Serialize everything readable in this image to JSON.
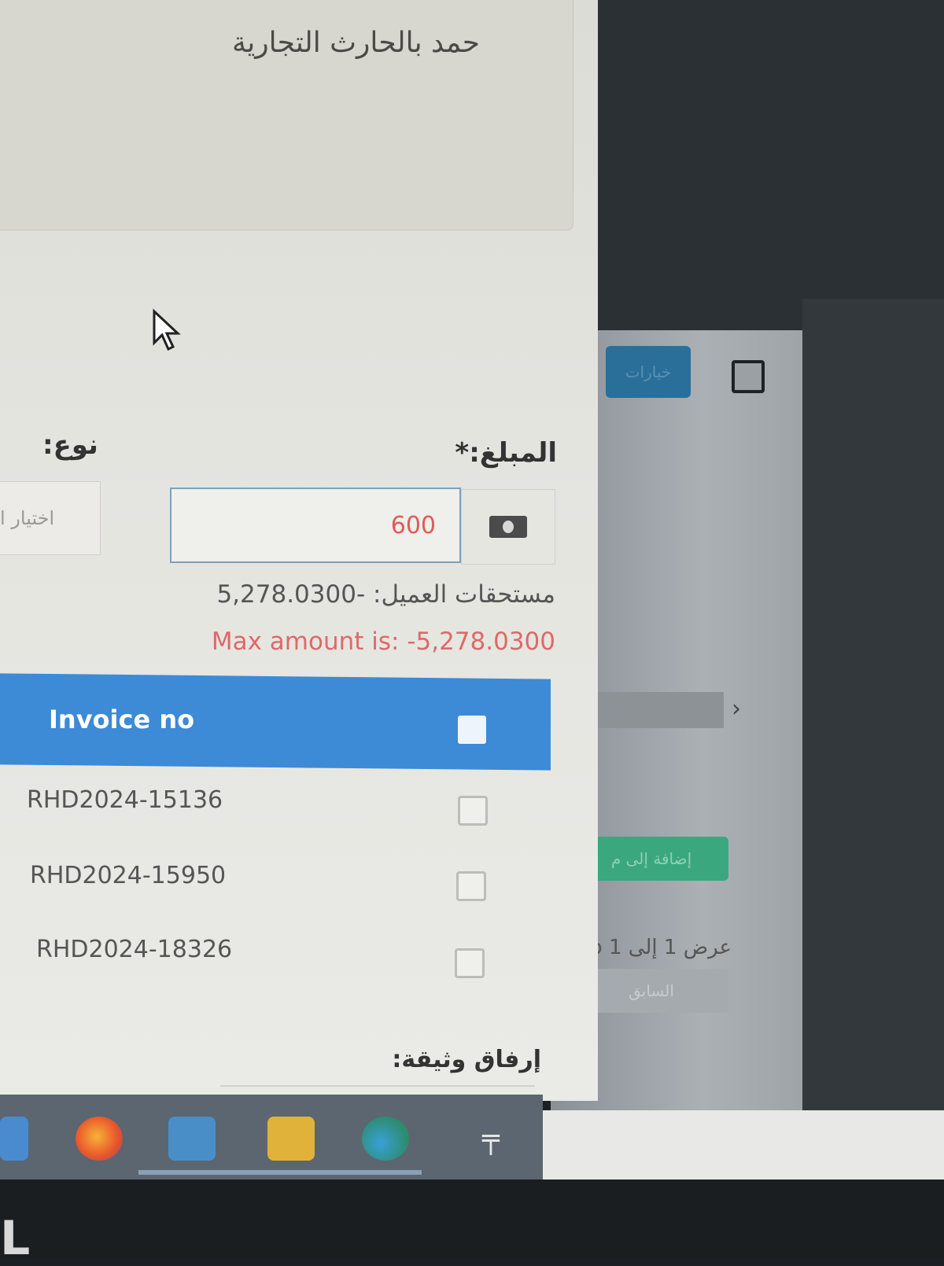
{
  "address": "حمد بالحارث التجارية",
  "form": {
    "amount_label": "المبلغ:*",
    "type_label": "نوع:",
    "amount_value": "600",
    "type_placeholder": "اختيار ا",
    "amount_icon": "money-icon",
    "customer_dues": "مستحقات العميل: -5,278.0300",
    "max_amount": "Max amount is: -5,278.0300",
    "attach_label": "إرفاق وثيقة:"
  },
  "invoice_table": {
    "header": "Invoice no",
    "rows": [
      "RHD2024-15136",
      "RHD2024-15950",
      "RHD2024-18326"
    ]
  },
  "background_page": {
    "button_label": "خيارات",
    "add_button": "إضافة إلى م",
    "showing": "عرض 1 إلى 1 o",
    "prev_button": "السابق"
  },
  "taskbar": {
    "icons": [
      "mail-icon",
      "firefox-icon",
      "store-icon",
      "file-explorer-icon",
      "edge-icon",
      "calculator-icon"
    ],
    "calc_glyph": "╤"
  },
  "colors": {
    "table_header": "#3d8ad6",
    "error_text": "#e06868",
    "input_border": "#7aa2bf"
  }
}
